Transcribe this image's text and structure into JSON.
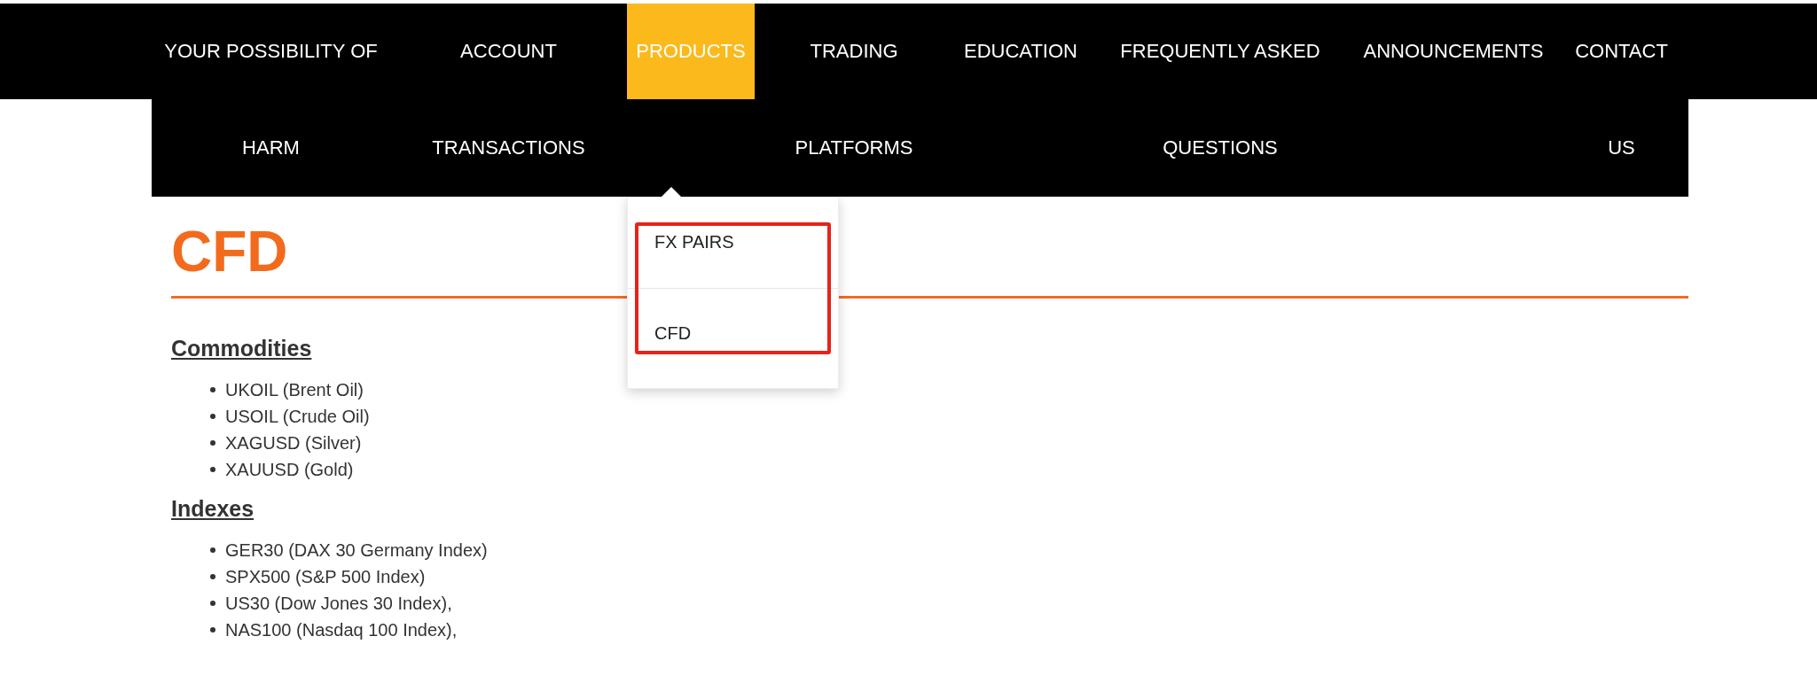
{
  "nav": {
    "items": [
      {
        "lines": [
          "YOUR POSSIBILITY OF",
          "HARM"
        ],
        "selected": false
      },
      {
        "lines": [
          "ACCOUNT",
          "TRANSACTIONS"
        ],
        "selected": false
      },
      {
        "lines": [
          "PRODUCTS"
        ],
        "selected": true
      },
      {
        "lines": [
          "TRADING",
          "PLATFORMS"
        ],
        "selected": false
      },
      {
        "lines": [
          "EDUCATION"
        ],
        "selected": false
      },
      {
        "lines": [
          "FREQUENTLY ASKED",
          "QUESTIONS"
        ],
        "selected": false
      },
      {
        "lines": [
          "ANNOUNCEMENTS"
        ],
        "selected": false
      },
      {
        "lines": [
          "CONTACT",
          "US"
        ],
        "selected": false
      }
    ],
    "dropdown": {
      "items": [
        "FX PAIRS",
        "CFD"
      ],
      "annotation_frame": true
    }
  },
  "page": {
    "title": "CFD",
    "sections": [
      {
        "heading": "Commodities",
        "items": [
          "UKOIL (Brent Oil)",
          "USOIL (Crude Oil)",
          "XAGUSD (Silver)",
          "XAUUSD (Gold)"
        ]
      },
      {
        "heading": "Indexes",
        "items": [
          "GER30 (DAX 30 Germany Index)",
          "SPX500 (S&P 500 Index)",
          "US30 (Dow Jones 30 Index),",
          "NAS100 (Nasdaq 100 Index),"
        ]
      }
    ]
  }
}
